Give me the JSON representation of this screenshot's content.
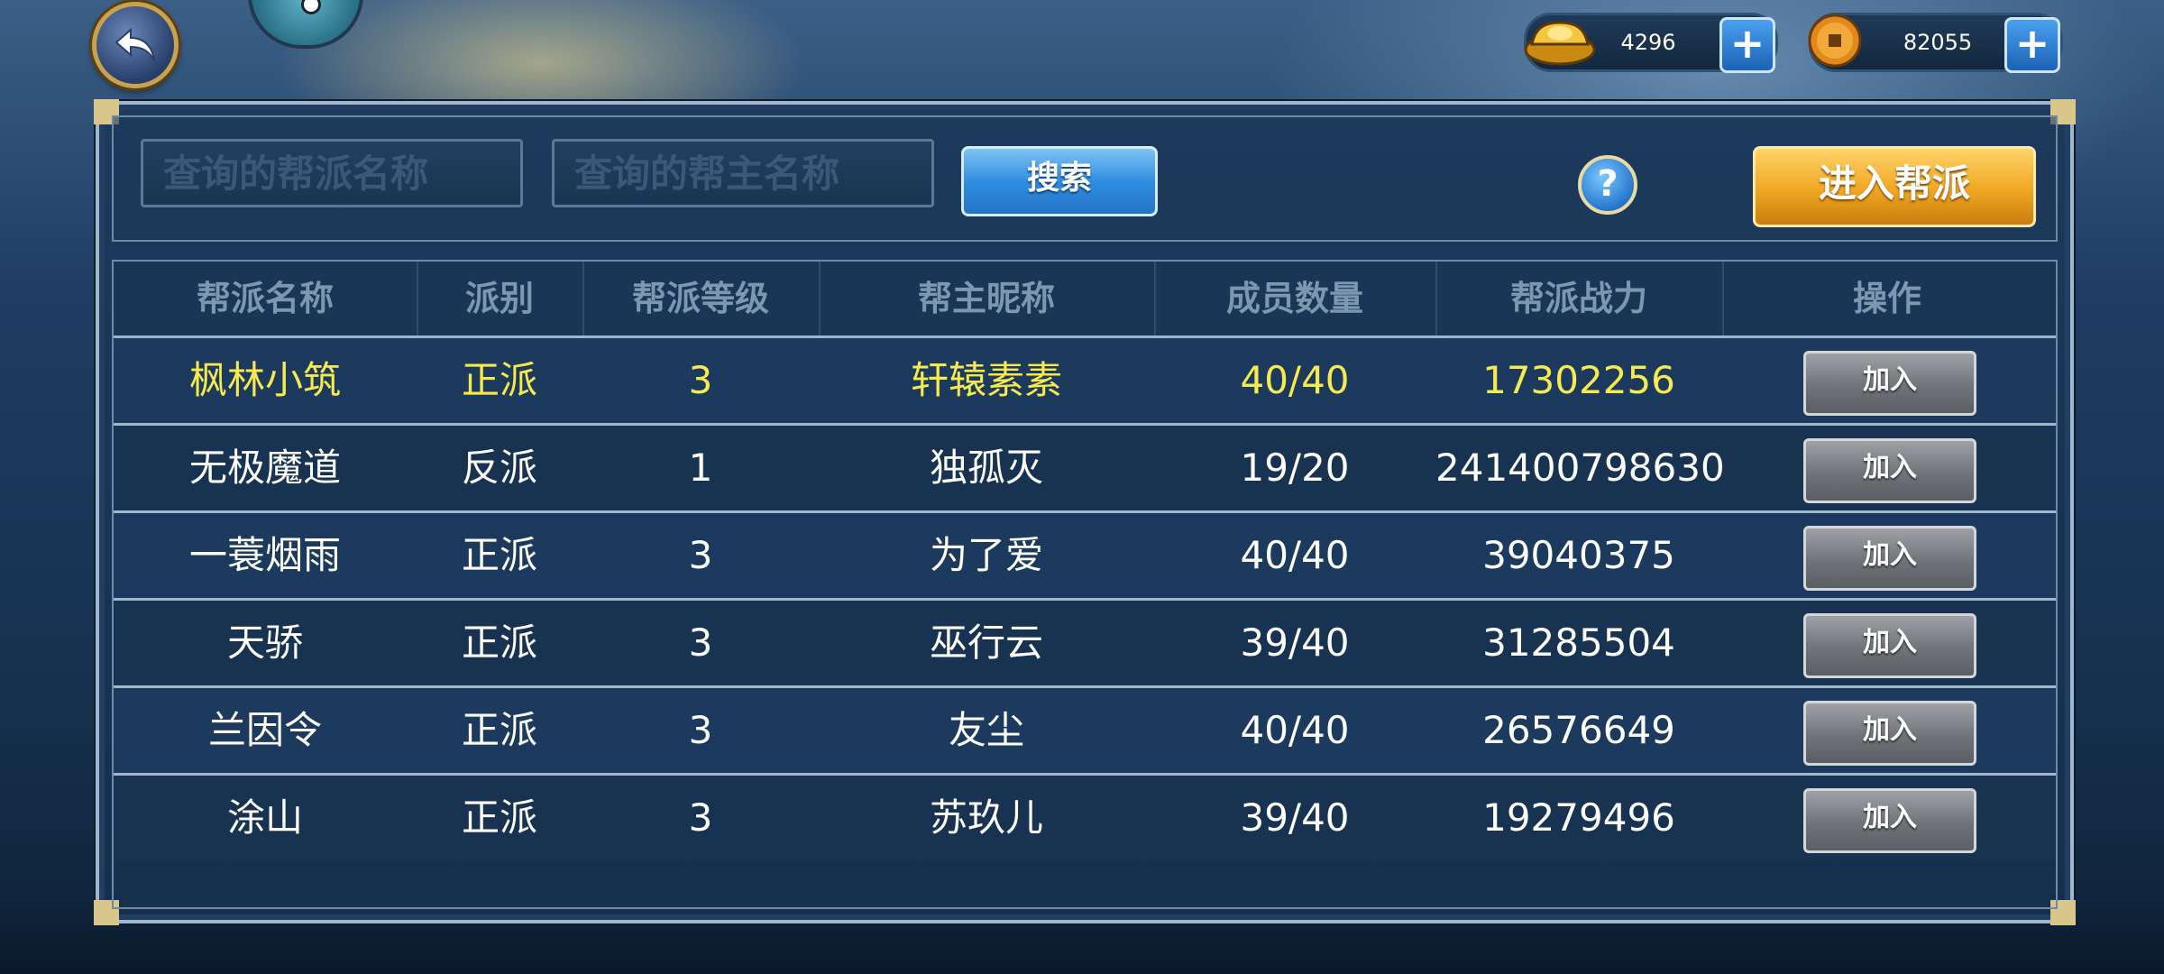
{
  "currencies": [
    {
      "icon": "gold-ingot-icon",
      "value": "4296"
    },
    {
      "icon": "copper-coin-icon",
      "value": "82055"
    }
  ],
  "search": {
    "guild_name_placeholder": "查询的帮派名称",
    "leader_name_placeholder": "查询的帮主名称",
    "search_label": "搜索",
    "help_label": "?",
    "enter_guild_label": "进入帮派"
  },
  "table": {
    "headers": [
      "帮派名称",
      "派别",
      "帮派等级",
      "帮主昵称",
      "成员数量",
      "帮派战力",
      "操作"
    ],
    "rows": [
      {
        "name": "枫林小筑",
        "faction": "正派",
        "level": "3",
        "leader": "轩辕素素",
        "members": "40/40",
        "power": "17302256",
        "action": "加入"
      },
      {
        "name": "无极魔道",
        "faction": "反派",
        "level": "1",
        "leader": "独孤灭",
        "members": "19/20",
        "power": "241400798630",
        "action": "加入"
      },
      {
        "name": "一蓑烟雨",
        "faction": "正派",
        "level": "3",
        "leader": "为了爱",
        "members": "40/40",
        "power": "39040375",
        "action": "加入"
      },
      {
        "name": "天骄",
        "faction": "正派",
        "level": "3",
        "leader": "巫行云",
        "members": "39/40",
        "power": "31285504",
        "action": "加入"
      },
      {
        "name": "兰因令",
        "faction": "正派",
        "level": "3",
        "leader": "友尘",
        "members": "40/40",
        "power": "26576649",
        "action": "加入"
      },
      {
        "name": "涂山",
        "faction": "正派",
        "level": "3",
        "leader": "苏玖儿",
        "members": "39/40",
        "power": "19279496",
        "action": "加入"
      }
    ]
  },
  "colors": {
    "highlight_text": "#f7ea4e",
    "normal_text": "#ffffff",
    "header_text": "#7e97b1"
  }
}
